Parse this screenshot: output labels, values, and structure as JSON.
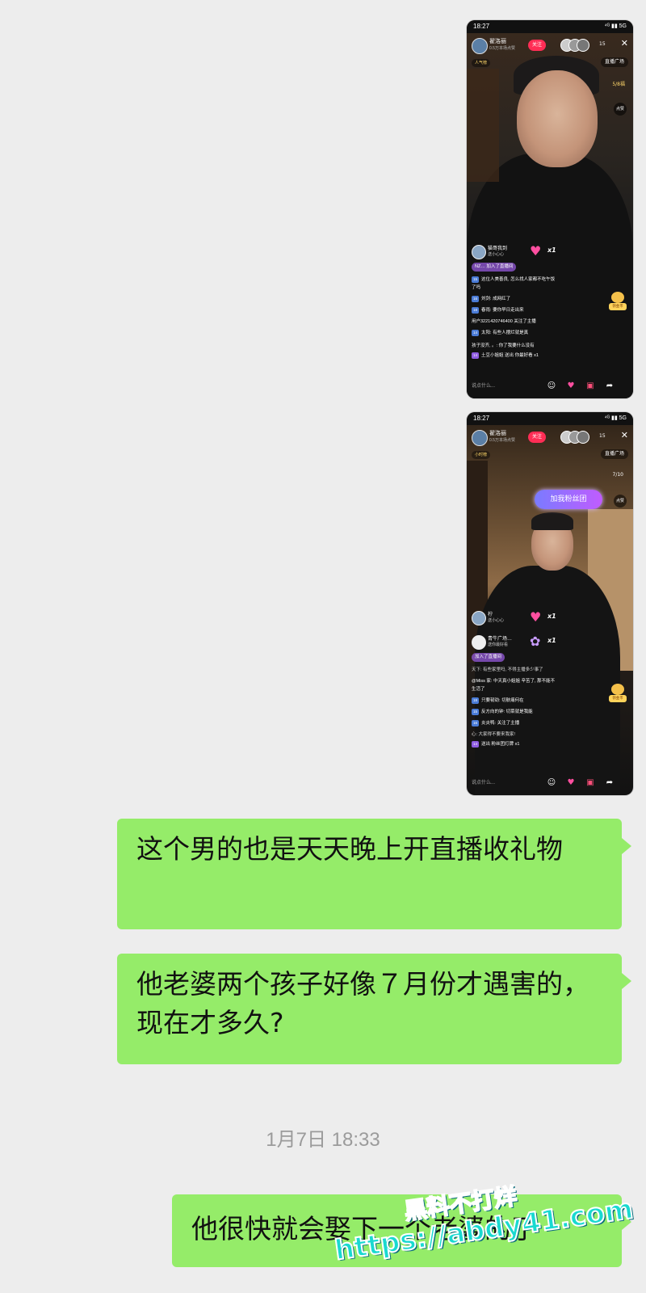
{
  "screenshots": [
    {
      "status_time": "18:27",
      "status_right": "⁴ᴳ ▮▮ 5G",
      "host_name": "翟洛丽",
      "host_sub": "0.5万本场点赞",
      "follow": "关注",
      "viewer_count": "15",
      "close": "✕",
      "rank": "人气榜",
      "square": "直播广场",
      "goal": "5/8福",
      "like_btn": "点赞",
      "gift_user": "猫哥我到",
      "gift_sub": "送小心心",
      "join_text": "加入了直播间",
      "join_user": "NZ…",
      "chat": [
        {
          "tag": "15",
          "text": "这位人美善良, 怎么找人家都不吃午饭"
        },
        {
          "tag": "",
          "text": "了吗"
        },
        {
          "tag": "16",
          "text": "刘剑: 成网红了"
        },
        {
          "tag": "18",
          "text": "春雨: 要你早日走出来"
        },
        {
          "tag": "",
          "text": "用户3221420746400 关注了主播"
        },
        {
          "tag": "14",
          "text": "太阳: 有些人摆烂就是真"
        },
        {
          "tag": "",
          "text": "孩子没齐, 。: 你了我要什么没有"
        },
        {
          "tag": "14",
          "text": "土豆小姐姐 送出 你最好看 x1"
        }
      ],
      "say": "说点什么...",
      "bear": "领金币"
    },
    {
      "status_time": "18:27",
      "status_right": "⁴ᴳ ▮▮ 5G",
      "host_name": "翟洛丽",
      "host_sub": "0.5万本场点赞",
      "follow": "关注",
      "viewer_count": "15",
      "close": "✕",
      "rank": "小时榜",
      "square": "直播广场",
      "goal": "7/10",
      "like_btn": "点赞",
      "fan_badge": "加我粉丝团",
      "gift_user": "柠",
      "gift_sub": "送小心心",
      "gift_user2": "青牛广场…",
      "gift_sub2": "送你最好看",
      "join_text": "加入了直播间",
      "chat": [
        {
          "tag": "",
          "text": "天下: 有些家里吗, 不得主播多少事了"
        },
        {
          "tag": "",
          "text": "@Miss 家: 中天真小姐姐 辛苦了, 那不能不"
        },
        {
          "tag": "",
          "text": "生活了"
        },
        {
          "tag": "18",
          "text": "只要韧劲: 切肤痛何在"
        },
        {
          "tag": "15",
          "text": "反方向的钟: 切菜就是我能"
        },
        {
          "tag": "16",
          "text": "炎炎鸭: 关注了主播"
        },
        {
          "tag": "",
          "text": "心: 大家得不要来我家!"
        },
        {
          "tag": "14",
          "text": "送出 粉丝团灯牌 x1"
        }
      ],
      "say": "说点什么...",
      "bear": "领金币"
    }
  ],
  "messages": [
    {
      "text": "这个男的也是天天晚上开直播收礼物"
    },
    {
      "text": "他老婆两个孩子好像７月份才遇害的，现在才多久?"
    },
    {
      "text": "他很快就会娶下一个老婆的了"
    }
  ],
  "timestamp": "1月7日 18:33",
  "watermark": {
    "line1": "黑料不打烊",
    "line2": "https://abdy41.com"
  }
}
